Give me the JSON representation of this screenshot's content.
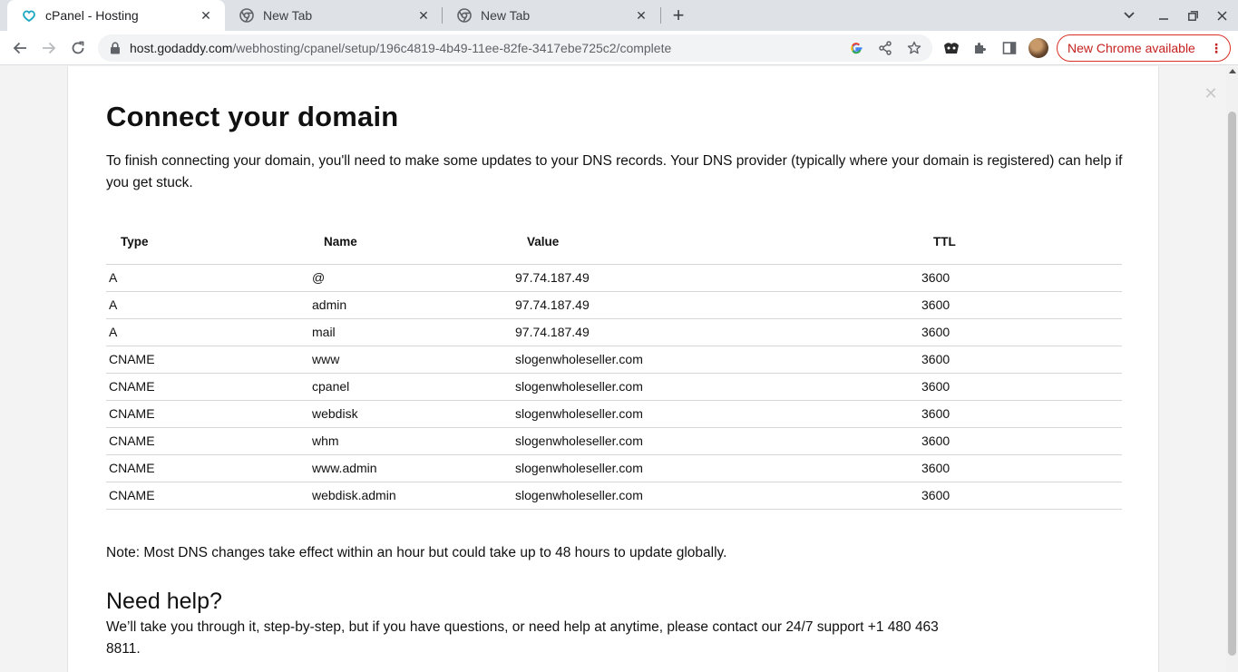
{
  "browser": {
    "tabs": [
      {
        "title": "cPanel - Hosting",
        "icon": "cpanel-icon",
        "active": true
      },
      {
        "title": "New Tab",
        "icon": "chrome-icon",
        "active": false
      },
      {
        "title": "New Tab",
        "icon": "chrome-icon",
        "active": false
      }
    ],
    "url_host": "host.godaddy.com",
    "url_path": "/webhosting/cpanel/setup/196c4819-4b49-11ee-82fe-3417ebe725c2/complete",
    "update_label": "New Chrome available"
  },
  "page": {
    "title": "Connect your domain",
    "intro": "To finish connecting your domain, you'll need to make some updates to your DNS records. Your DNS provider (typically where your domain is registered) can help if you get stuck.",
    "table": {
      "headers": [
        "Type",
        "Name",
        "Value",
        "TTL"
      ],
      "rows": [
        [
          "A",
          "@",
          "97.74.187.49",
          "3600"
        ],
        [
          "A",
          "admin",
          "97.74.187.49",
          "3600"
        ],
        [
          "A",
          "mail",
          "97.74.187.49",
          "3600"
        ],
        [
          "CNAME",
          "www",
          "slogenwholeseller.com",
          "3600"
        ],
        [
          "CNAME",
          "cpanel",
          "slogenwholeseller.com",
          "3600"
        ],
        [
          "CNAME",
          "webdisk",
          "slogenwholeseller.com",
          "3600"
        ],
        [
          "CNAME",
          "whm",
          "slogenwholeseller.com",
          "3600"
        ],
        [
          "CNAME",
          "www.admin",
          "slogenwholeseller.com",
          "3600"
        ],
        [
          "CNAME",
          "webdisk.admin",
          "slogenwholeseller.com",
          "3600"
        ]
      ]
    },
    "note": "Note: Most DNS changes take effect within an hour but could take up to 48 hours to update globally.",
    "help_title": "Need help?",
    "help_text": "We’ll take you through it, step-by-step, but if you have questions, or need help at anytime, please contact our 24/7 support +1 480 463 8811."
  },
  "colors": {
    "tabstrip": "#dee1e6",
    "update_accent": "#d93025",
    "cpanel_icon": "#1aa7c2"
  }
}
